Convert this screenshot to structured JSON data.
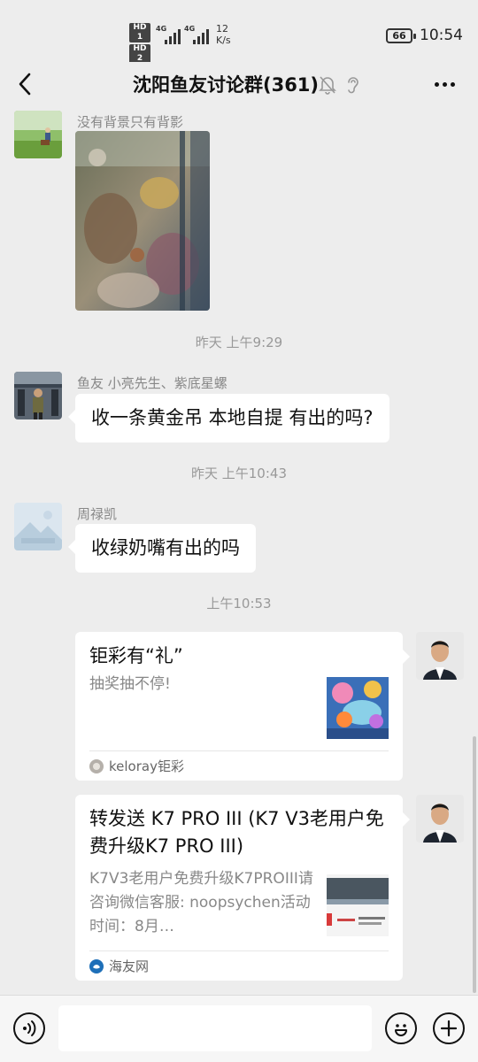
{
  "status_bar": {
    "hd1": "HD 1",
    "hd2": "HD 2",
    "net1": "4G",
    "net2": "4G",
    "speed_value": "12",
    "speed_unit": "K/s",
    "battery": "66",
    "time": "10:54"
  },
  "header": {
    "title": "沈阳鱼友讨论群(361)",
    "icons": [
      "back-arrow-icon",
      "mute-bell-icon",
      "ear-icon",
      "more-icon"
    ]
  },
  "messages": {
    "m1_sender": "没有背景只有背影",
    "t1": "昨天 上午9:29",
    "m2_sender": "鱼友 小亮先生、紫底星螺",
    "m2_text": "收一条黄金吊 本地自提 有出的吗?",
    "t2": "昨天 上午10:43",
    "m3_sender": "周禄凯",
    "m3_text": "收绿奶嘴有出的吗",
    "t3": "上午10:53",
    "card1": {
      "title": "钜彩有“礼”",
      "desc": "抽奖抽不停!",
      "source": "keloray钜彩"
    },
    "card2": {
      "title": "转发送 K7 PRO III (K7 V3老用户免费升级K7 PRO III)",
      "desc": "K7V3老用户免费升级K7PROIII请咨询微信客服: noopsychen活动时间：8月…",
      "source": "海友网"
    }
  },
  "input_bar": {
    "placeholder": ""
  },
  "colors": {
    "background": "#ededed",
    "bubble": "#ffffff",
    "timestamp": "#999999"
  }
}
